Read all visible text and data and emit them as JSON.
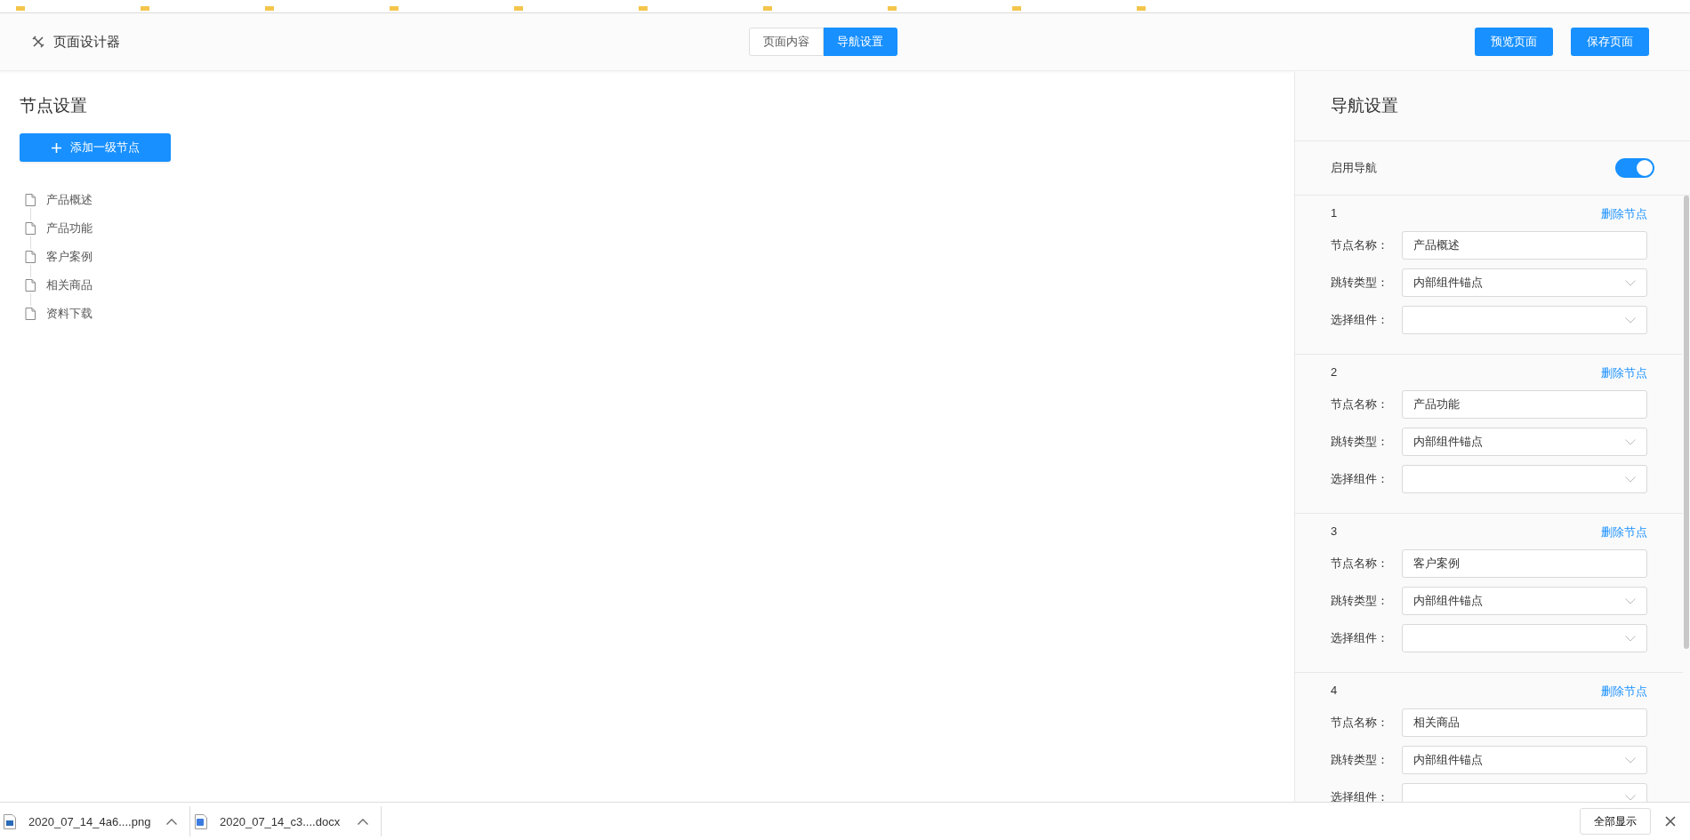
{
  "header": {
    "title": "页面设计器",
    "tabs": [
      {
        "label": "页面内容",
        "selected": false
      },
      {
        "label": "导航设置",
        "selected": true
      }
    ],
    "buttons": [
      "预览页面",
      "保存页面"
    ]
  },
  "node_panel": {
    "title": "节点设置",
    "add_button": "添加一级节点",
    "tree": [
      {
        "label": "产品概述"
      },
      {
        "label": "产品功能"
      },
      {
        "label": "客户案例"
      },
      {
        "label": "相关商品"
      },
      {
        "label": "资料下载"
      }
    ]
  },
  "nav_panel": {
    "title": "导航设置",
    "enable": {
      "label": "启用导航",
      "on": true
    },
    "nodes": [
      {
        "index": "1",
        "delete": "删除节点",
        "fields": [
          {
            "kind": "text",
            "label": "节点名称：",
            "value": "产品概述"
          },
          {
            "kind": "select",
            "label": "跳转类型：",
            "value": "内部组件锚点"
          },
          {
            "kind": "select",
            "label": "选择组件："
          }
        ]
      },
      {
        "index": "2",
        "delete": "删除节点",
        "fields": [
          {
            "kind": "text",
            "label": "节点名称：",
            "value": "产品功能"
          },
          {
            "kind": "select",
            "label": "跳转类型：",
            "value": "内部组件锚点"
          },
          {
            "kind": "select",
            "label": "选择组件："
          }
        ]
      },
      {
        "index": "3",
        "delete": "删除节点",
        "fields": [
          {
            "kind": "text",
            "label": "节点名称：",
            "value": "客户案例"
          },
          {
            "kind": "select",
            "label": "跳转类型：",
            "value": "内部组件锚点"
          },
          {
            "kind": "select",
            "label": "选择组件："
          }
        ]
      },
      {
        "index": "4",
        "delete": "删除节点",
        "fields": [
          {
            "kind": "text",
            "label": "节点名称：",
            "value": "相关商品"
          },
          {
            "kind": "select",
            "label": "跳转类型：",
            "value": "内部组件锚点"
          },
          {
            "kind": "select",
            "label": "选择组件："
          }
        ]
      }
    ]
  },
  "downloads": {
    "items": [
      {
        "kind": "image",
        "name": "2020_07_14_4a6....png"
      },
      {
        "kind": "word",
        "name": "2020_07_14_c3....docx"
      }
    ],
    "show_all": "全部显示"
  }
}
